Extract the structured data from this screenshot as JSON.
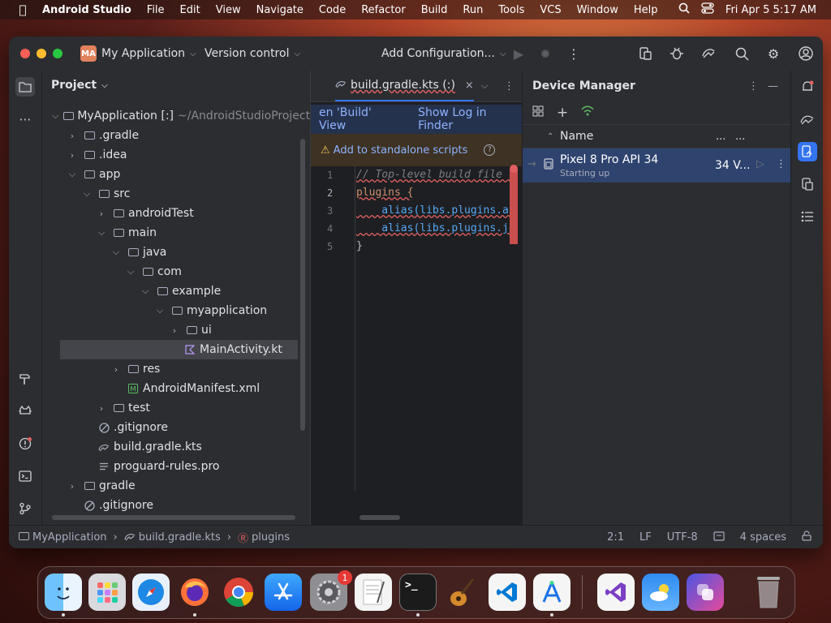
{
  "menubar": {
    "app_name": "Android Studio",
    "items": [
      "File",
      "Edit",
      "View",
      "Navigate",
      "Code",
      "Refactor",
      "Build",
      "Run",
      "Tools",
      "VCS",
      "Window",
      "Help"
    ],
    "datetime": "Fri Apr 5  5:17 AM"
  },
  "titlebar": {
    "project_badge": "MA",
    "project_name": "My Application",
    "vcs_label": "Version control",
    "run_config": "Add Configuration..."
  },
  "project_panel": {
    "title": "Project",
    "tree": [
      {
        "label": "MyApplication [:]",
        "suffix": "~/AndroidStudioProjects",
        "type": "module",
        "chevron": "down"
      },
      {
        "label": ".gradle",
        "type": "folder",
        "chevron": "right"
      },
      {
        "label": ".idea",
        "type": "folder",
        "chevron": "right"
      },
      {
        "label": "app",
        "type": "folder",
        "chevron": "down"
      },
      {
        "label": "src",
        "type": "folder",
        "chevron": "down"
      },
      {
        "label": "androidTest",
        "type": "folder",
        "chevron": "right"
      },
      {
        "label": "main",
        "type": "folder",
        "chevron": "down"
      },
      {
        "label": "java",
        "type": "folder",
        "chevron": "down"
      },
      {
        "label": "com",
        "type": "folder",
        "chevron": "down"
      },
      {
        "label": "example",
        "type": "folder",
        "chevron": "down"
      },
      {
        "label": "myapplication",
        "type": "folder",
        "chevron": "down"
      },
      {
        "label": "ui",
        "type": "folder",
        "chevron": "right"
      },
      {
        "label": "MainActivity.kt",
        "type": "kotlin",
        "chevron": ""
      },
      {
        "label": "res",
        "type": "folder",
        "chevron": "right"
      },
      {
        "label": "AndroidManifest.xml",
        "type": "manifest",
        "chevron": ""
      },
      {
        "label": "test",
        "type": "folder",
        "chevron": "right"
      },
      {
        "label": ".gitignore",
        "type": "ignore",
        "chevron": ""
      },
      {
        "label": "build.gradle.kts",
        "type": "gradle",
        "chevron": ""
      },
      {
        "label": "proguard-rules.pro",
        "type": "text",
        "chevron": ""
      },
      {
        "label": "gradle",
        "type": "folder",
        "chevron": "right"
      },
      {
        "label": ".gitignore",
        "type": "ignore",
        "chevron": ""
      }
    ]
  },
  "editor": {
    "tab_label": "build.gradle.kts (:)",
    "info_link_1": "en 'Build' View",
    "info_link_2": "Show Log in Finder",
    "warning_text": "Add to standalone scripts",
    "line_numbers": [
      "1",
      "2",
      "3",
      "4",
      "5"
    ],
    "code_lines": [
      "// Top-level build file c",
      "plugins {",
      "    alias(libs.plugins.an",
      "    alias(libs.plugins.jo",
      "}"
    ]
  },
  "device_manager": {
    "title": "Device Manager",
    "column_name": "Name",
    "column_2": "...",
    "column_3": "...",
    "devices": [
      {
        "name": "Pixel 8 Pro API 34",
        "status": "Starting up",
        "api": "34 V..."
      }
    ]
  },
  "statusbar": {
    "breadcrumbs": [
      "MyApplication",
      "build.gradle.kts",
      "plugins"
    ],
    "caret": "2:1",
    "line_separator": "LF",
    "encoding": "UTF-8",
    "indent": "4 spaces"
  },
  "dock": {
    "apps": [
      "Finder",
      "Launchpad",
      "Safari",
      "Firefox",
      "Chrome",
      "App Store",
      "System Settings",
      "TextEdit",
      "Terminal",
      "GarageBand",
      "Visual Studio Code",
      "Android Studio",
      "Visual Studio",
      "Weather",
      "Shortcuts",
      "Trash"
    ],
    "settings_badge": "1"
  },
  "colors": {
    "accent": "#3574f0",
    "selected_row": "#2e436e",
    "error": "#e06060"
  }
}
